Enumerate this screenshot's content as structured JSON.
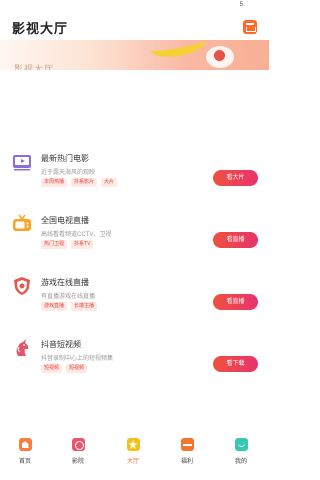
{
  "status": {
    "indicator": "5"
  },
  "header": {
    "title": "影视大厅"
  },
  "banner": {
    "text": "影视大厅"
  },
  "cards": [
    {
      "title": "最新热门电影",
      "desc": "近于露天海风的观映",
      "tags": [
        "本周热播",
        "抖系影片",
        "大片"
      ],
      "button": "看大片",
      "icon": "film-screen-icon",
      "icon_color": "#8e6cd9"
    },
    {
      "title": "全国电视直播",
      "desc": "高线看看频道CCTV、卫视",
      "tags": [
        "热门卫视",
        "抖系TV"
      ],
      "button": "看直播",
      "icon": "tv-icon",
      "icon_color": "#f6a523"
    },
    {
      "title": "游戏在线直播",
      "desc": "有直播游戏在线直播",
      "tags": [
        "游戏直播",
        "长端主播"
      ],
      "button": "看直播",
      "icon": "game-shield-icon",
      "icon_color": "#e55a4f"
    },
    {
      "title": "抖音短视频",
      "desc": "抖音录制中心上的短视频集",
      "tags": [
        "短视频",
        "短视频"
      ],
      "button": "看下载",
      "icon": "unicorn-icon",
      "icon_color": "#e5566a"
    }
  ],
  "tabbar": {
    "items": [
      {
        "label": "首页",
        "icon": "home-icon"
      },
      {
        "label": "影院",
        "icon": "cinema-icon"
      },
      {
        "label": "大厅",
        "icon": "hall-star-icon",
        "active": true
      },
      {
        "label": "福利",
        "icon": "gift-icon"
      },
      {
        "label": "我的",
        "icon": "profile-icon"
      }
    ]
  },
  "colors": {
    "accent": "#ff6a2b",
    "button_gradient_start": "#f0513e",
    "button_gradient_end": "#e8336c",
    "tag_text": "#e5433a",
    "tag_bg": "#ffe9e5"
  }
}
